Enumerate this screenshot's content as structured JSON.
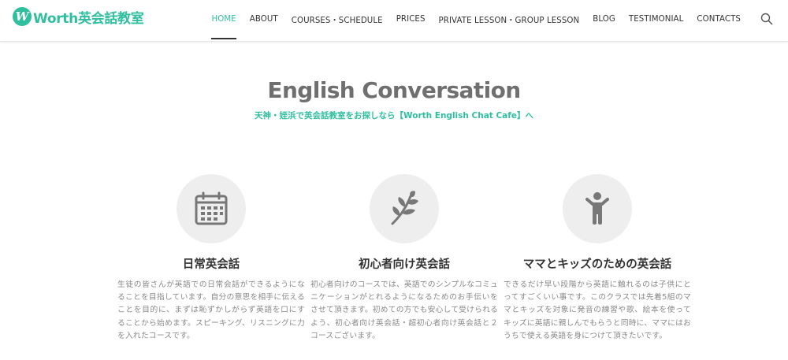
{
  "header": {
    "logo_mark": "W",
    "logo_text": "Worth英会話教室",
    "nav": [
      {
        "label": "HOME",
        "active": true
      },
      {
        "label": "ABOUT",
        "active": false
      },
      {
        "label": "COURSES・SCHEDULE",
        "active": false
      },
      {
        "label": "PRICES",
        "active": false
      },
      {
        "label": "PRIVATE LESSON・GROUP LESSON",
        "active": false
      },
      {
        "label": "BLOG",
        "active": false
      },
      {
        "label": "TESTIMONIAL",
        "active": false
      },
      {
        "label": "CONTACTS",
        "active": false
      }
    ],
    "search_icon": "search-icon"
  },
  "main": {
    "title": "English Conversation",
    "subtitle": "天神・姪浜で英会話教室をお探しなら【Worth English Chat Cafe】へ",
    "features": [
      {
        "icon": "calendar-icon",
        "title": "日常英会話",
        "description": "生徒の皆さんが英語での日常会話ができるようになることを目指しています。自分の意思を相手に伝えることを目的に、まずは恥ずかしがらず英語を口にすることから始めます。スピーキング、リスニングに力を入れたコースです。"
      },
      {
        "icon": "sprout-icon",
        "title": "初心者向け英会話",
        "description": "初心者向けのコースでは、英語でのシンプルなコミュニケーションがとれるようになるためのお手伝いをさせて頂きます。初めての方でも安心して受けられるよう、初心者向け英会話・超初心者向け英会話と２コースございます。"
      },
      {
        "icon": "child-icon",
        "title": "ママとキッズのための英会話",
        "description": "できるだけ早い段階から英語に触れるのは子供にとってすごくいい事です。このクラスでは先着5組のママとキッズを対象に発音の練習や歌、絵本を使ってキッズに英語に親しんでもらうと同時に、ママにはおうちで使える英語を身につけて頂きたいです。"
      }
    ]
  },
  "colors": {
    "accent": "#2fbf9f",
    "title_gray": "#6f6f6f",
    "text_gray": "#888888",
    "circle_bg": "#eeeeee",
    "icon_gray": "#777777"
  }
}
